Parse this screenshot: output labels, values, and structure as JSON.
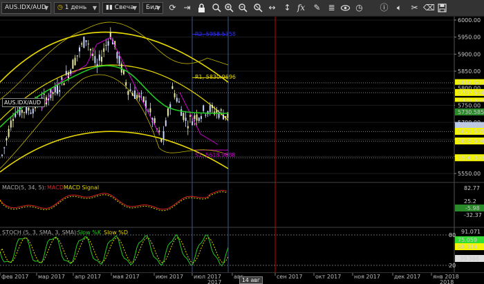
{
  "toolbar": {
    "symbol": "AUS.IDX/AUD",
    "timeframe": "1 день",
    "chart_type": "Свеча",
    "price_type": "Бид",
    "icons": [
      "refresh-icon",
      "forward-icon",
      "lock-icon",
      "zoom-icon",
      "zoom-in-icon",
      "zoom-out-icon",
      "zoom-reset-icon",
      "resize-horizontal-icon",
      "resize-vertical-icon",
      "function-icon",
      "pencil-icon",
      "layers-icon",
      "eye-icon",
      "clock-icon",
      "info-icon",
      "sound-icon",
      "tools-icon",
      "save-icon"
    ]
  },
  "symbol_label": "AUS.IDX/AUD",
  "price_axis": {
    "ticks": [
      "6000.00",
      "5950.00",
      "5900.00",
      "5850.00",
      "5800.00",
      "5750.00",
      "5700.00",
      "5650.00",
      "5600.00",
      "5550.00"
    ],
    "badges": [
      {
        "text": "5816.501",
        "bg": "#f5f500",
        "fg": "#000"
      },
      {
        "text": "5800.00",
        "bg": "#000",
        "fg": "#ccc"
      },
      {
        "text": "5787.584",
        "bg": "#f5f500",
        "fg": "#000"
      },
      {
        "text": "5762.392",
        "bg": "#f5f500",
        "fg": "#000"
      },
      {
        "text": "5750.00",
        "bg": "#000",
        "fg": "#ccc"
      },
      {
        "text": "5730.585",
        "bg": "#2a8a2a",
        "fg": "#fff"
      },
      {
        "text": "5700.00",
        "bg": "#000",
        "fg": "#888"
      },
      {
        "text": "5690.970",
        "bg": "#b8c8e8",
        "fg": "#000"
      },
      {
        "text": "5673.585",
        "bg": "#f5f500",
        "fg": "#000"
      },
      {
        "text": "5645.504",
        "bg": "#f5f500",
        "fg": "#000"
      },
      {
        "text": "5596.303",
        "bg": "#f5f500",
        "fg": "#000"
      }
    ]
  },
  "pivot_labels": {
    "r2": "R2, 5958.5358",
    "r1": "R1, 5830.9696",
    "s1": "S1, 5618.9888"
  },
  "macd": {
    "title": "MACD(5, 34, 5):",
    "macd_label": "MACD",
    "signal_label": "MACD Signal",
    "ticks": [
      "82.77",
      "25.2",
      "-32.37"
    ],
    "badge": "-5.98"
  },
  "stoch": {
    "title": "STOCH (5, 3, SMA, 3, SMA):",
    "k_label": "Slow %K",
    "d_label": "Slow %D",
    "ticks": [
      "91.071",
      "39.366"
    ],
    "badge_k": "75.059",
    "badge_d": "68.314",
    "level_high": "80",
    "level_low": "20"
  },
  "x_axis": {
    "labels": [
      "фев 2017",
      "мар 2017",
      "апр 2017",
      "мая 2017",
      "июн 2017",
      "июл 2017",
      "авг",
      "сен 2017",
      "окт 2017",
      "ноя 2017",
      "дек 2017",
      "янв 2018"
    ],
    "year_left": "2017",
    "year_right": "2018",
    "cursor_date": "14 авг"
  },
  "colors": {
    "background": "#000000",
    "toolbar": "#333333",
    "bull_candle": "#c8d8ff",
    "bear_candle": "#e8e8a0",
    "ma_green": "#22cc22",
    "channel_yellow": "#e6d800",
    "pivot_blue": "#3030ff",
    "pivot_magenta": "#cc00cc",
    "cursor_red": "#cc0000",
    "macd_red": "#dd2222",
    "macd_yellow": "#e6d800",
    "stoch_green": "#22cc22",
    "stoch_yellow": "#e6d800"
  }
}
